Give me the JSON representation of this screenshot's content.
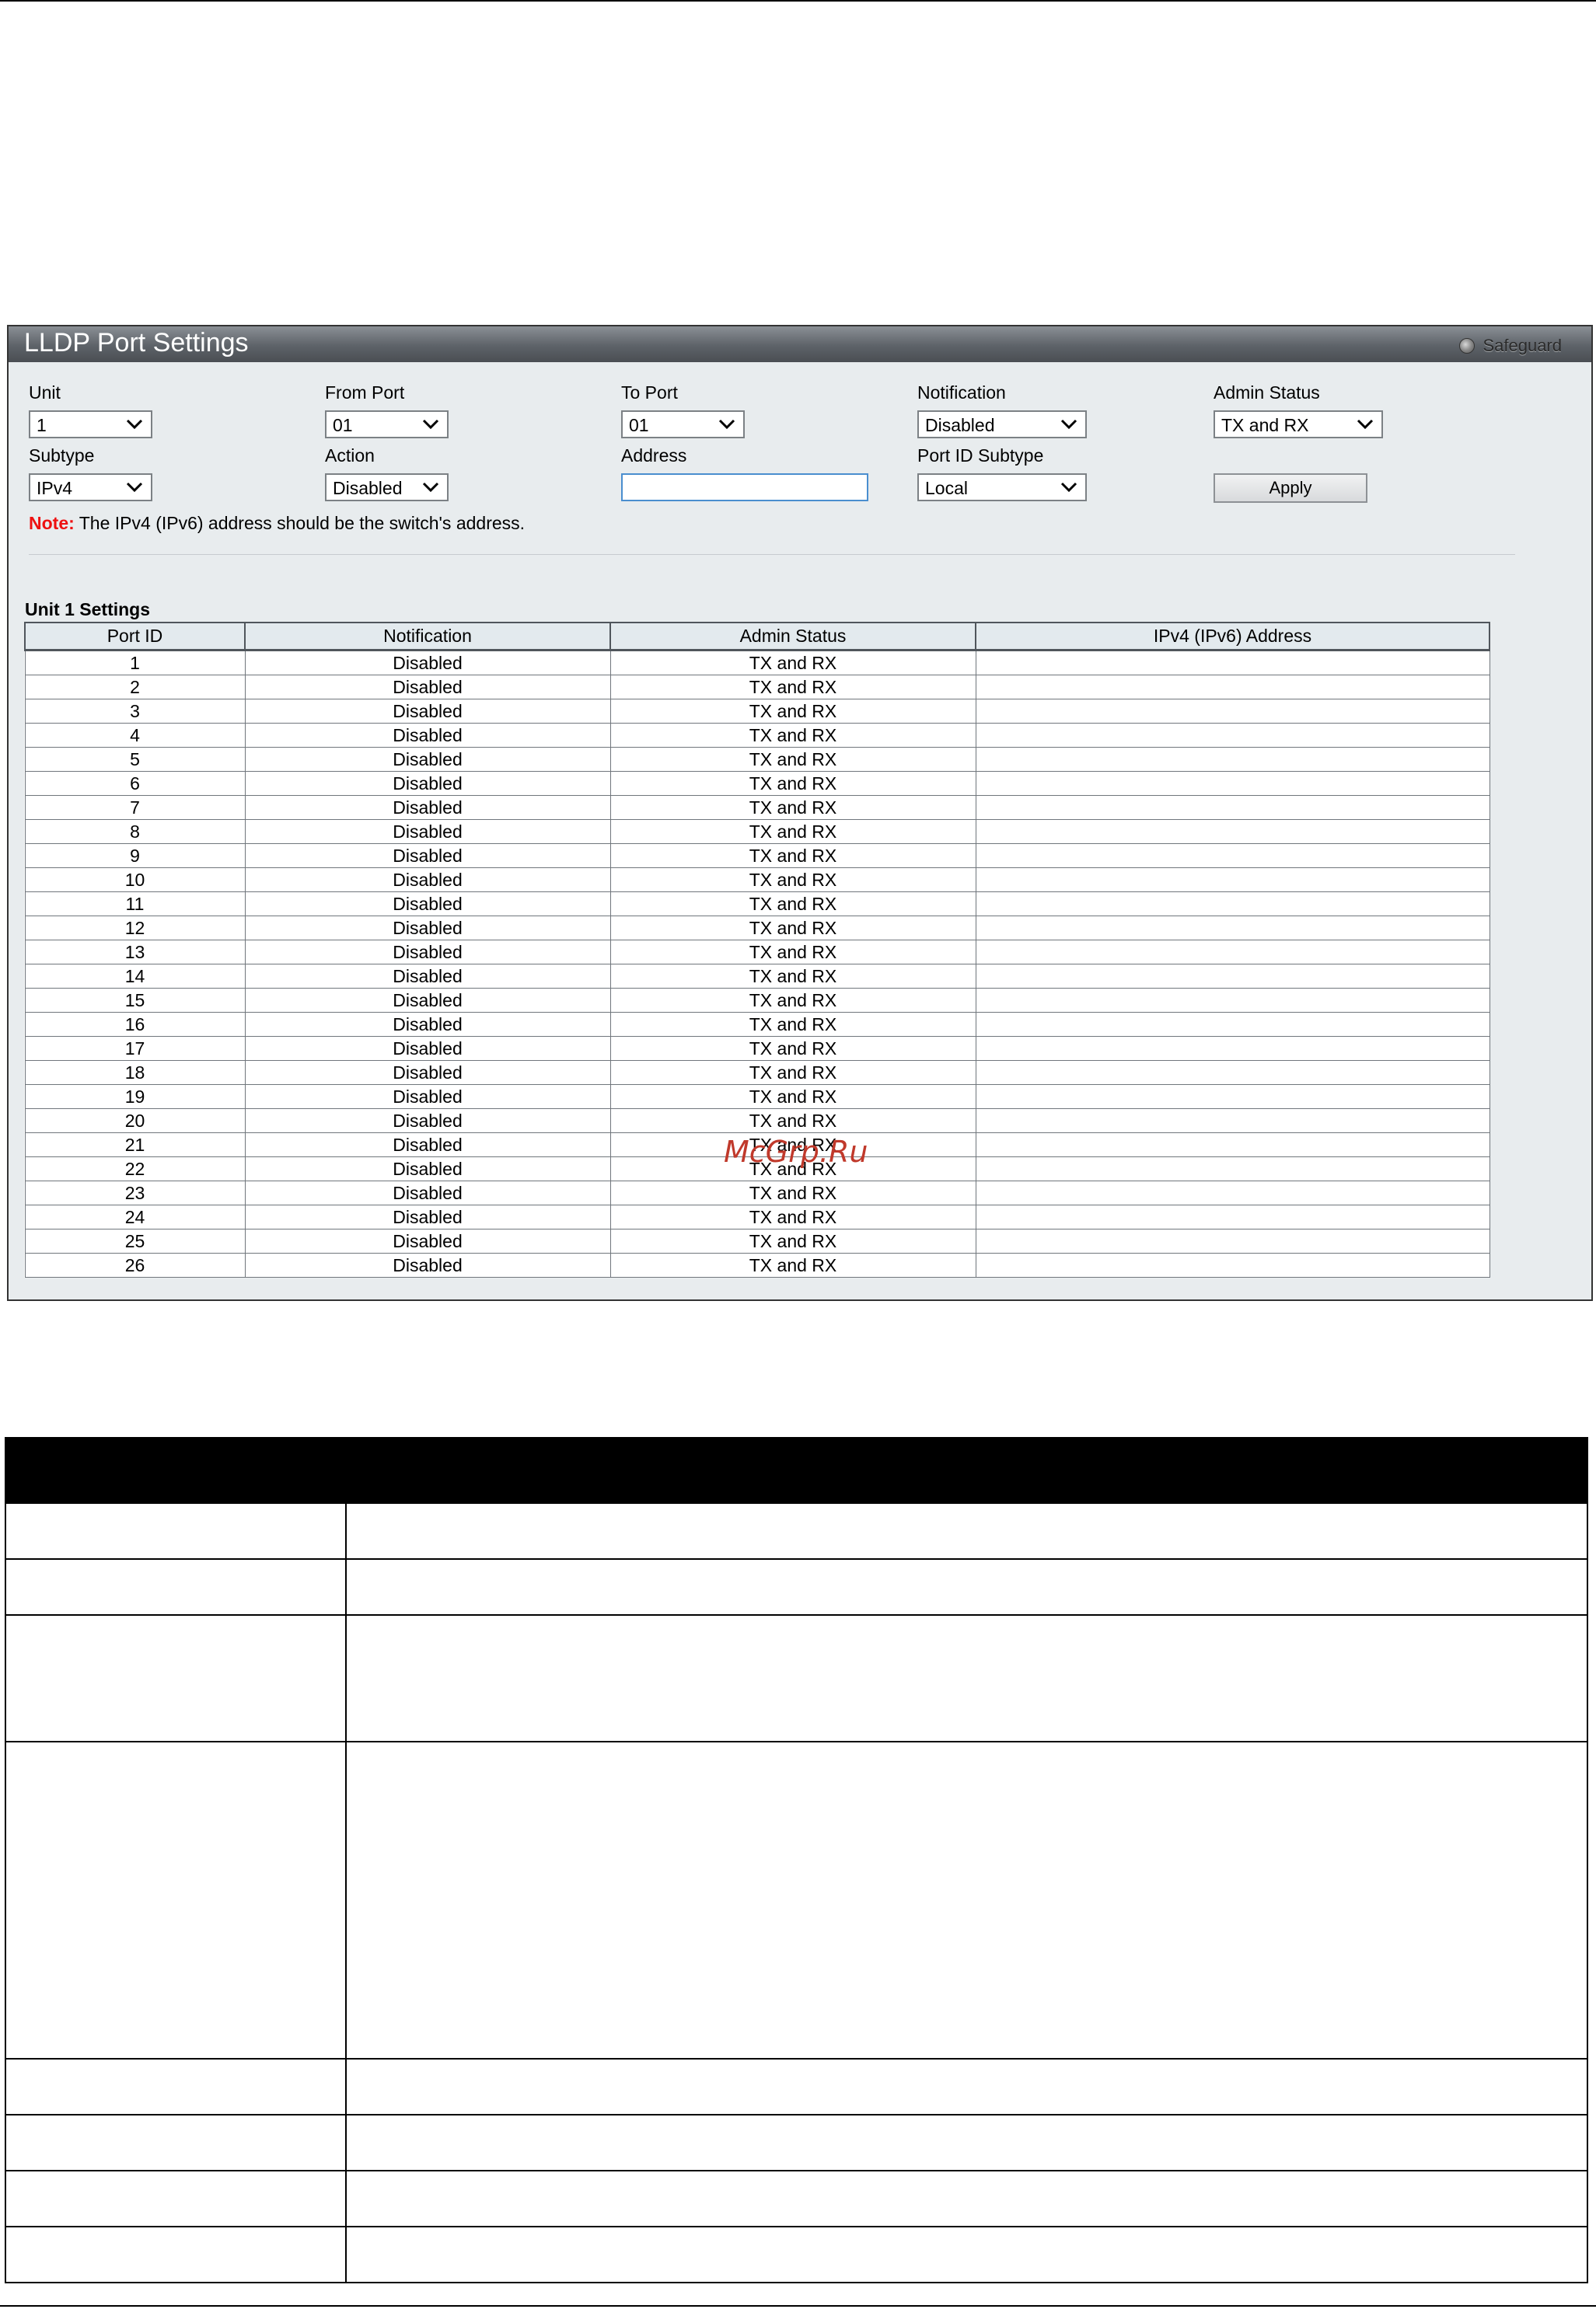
{
  "panel": {
    "title": "LLDP Port Settings",
    "safeguard_label": "Safeguard"
  },
  "form": {
    "unit": {
      "label": "Unit",
      "value": "1"
    },
    "from_port": {
      "label": "From Port",
      "value": "01"
    },
    "to_port": {
      "label": "To Port",
      "value": "01"
    },
    "notification": {
      "label": "Notification",
      "value": "Disabled"
    },
    "admin_status": {
      "label": "Admin Status",
      "value": "TX and RX"
    },
    "subtype": {
      "label": "Subtype",
      "value": "IPv4"
    },
    "action": {
      "label": "Action",
      "value": "Disabled"
    },
    "address": {
      "label": "Address",
      "value": ""
    },
    "port_id_subtype": {
      "label": "Port ID Subtype",
      "value": "Local"
    },
    "apply_label": "Apply",
    "note_key": "Note:",
    "note_text": " The IPv4 (IPv6) address should be the switch's address."
  },
  "table": {
    "title": "Unit 1 Settings",
    "headers": [
      "Port ID",
      "Notification",
      "Admin Status",
      "IPv4 (IPv6) Address"
    ],
    "rows": [
      [
        "1",
        "Disabled",
        "TX and RX",
        ""
      ],
      [
        "2",
        "Disabled",
        "TX and RX",
        ""
      ],
      [
        "3",
        "Disabled",
        "TX and RX",
        ""
      ],
      [
        "4",
        "Disabled",
        "TX and RX",
        ""
      ],
      [
        "5",
        "Disabled",
        "TX and RX",
        ""
      ],
      [
        "6",
        "Disabled",
        "TX and RX",
        ""
      ],
      [
        "7",
        "Disabled",
        "TX and RX",
        ""
      ],
      [
        "8",
        "Disabled",
        "TX and RX",
        ""
      ],
      [
        "9",
        "Disabled",
        "TX and RX",
        ""
      ],
      [
        "10",
        "Disabled",
        "TX and RX",
        ""
      ],
      [
        "11",
        "Disabled",
        "TX and RX",
        ""
      ],
      [
        "12",
        "Disabled",
        "TX and RX",
        ""
      ],
      [
        "13",
        "Disabled",
        "TX and RX",
        ""
      ],
      [
        "14",
        "Disabled",
        "TX and RX",
        ""
      ],
      [
        "15",
        "Disabled",
        "TX and RX",
        ""
      ],
      [
        "16",
        "Disabled",
        "TX and RX",
        ""
      ],
      [
        "17",
        "Disabled",
        "TX and RX",
        ""
      ],
      [
        "18",
        "Disabled",
        "TX and RX",
        ""
      ],
      [
        "19",
        "Disabled",
        "TX and RX",
        ""
      ],
      [
        "20",
        "Disabled",
        "TX and RX",
        ""
      ],
      [
        "21",
        "Disabled",
        "TX and RX",
        ""
      ],
      [
        "22",
        "Disabled",
        "TX and RX",
        ""
      ],
      [
        "23",
        "Disabled",
        "TX and RX",
        ""
      ],
      [
        "24",
        "Disabled",
        "TX and RX",
        ""
      ],
      [
        "25",
        "Disabled",
        "TX and RX",
        ""
      ],
      [
        "26",
        "Disabled",
        "TX and RX",
        ""
      ]
    ]
  },
  "watermark": "McGrp.Ru",
  "colors": {
    "note_red": "#ee1111",
    "titlebar_gray": "#5d6268",
    "panel_bg": "#e8ecee",
    "input_focus_blue": "#4a8ecf"
  }
}
